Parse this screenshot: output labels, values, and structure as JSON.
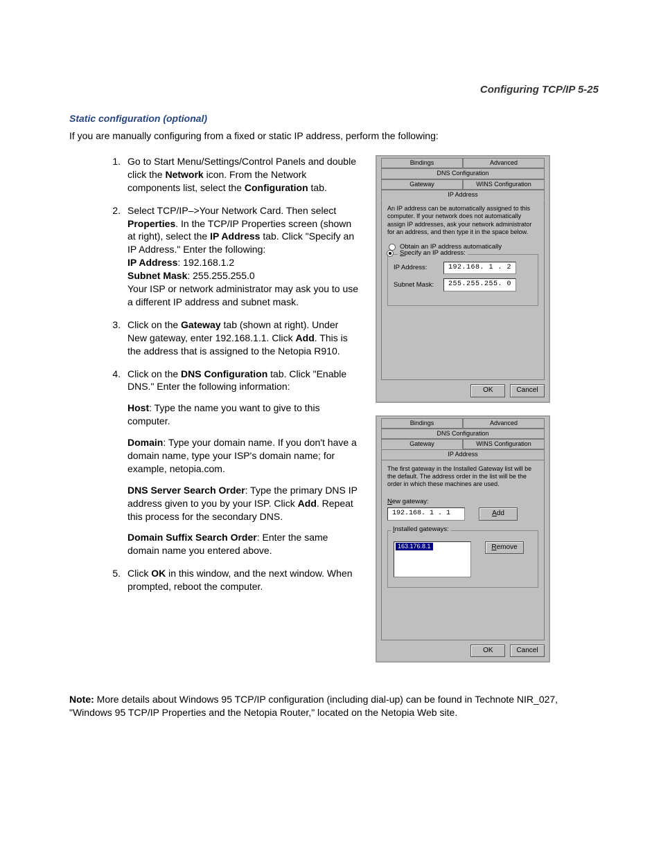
{
  "header": "Configuring TCP/IP   5-25",
  "subhead": "Static configuration (optional)",
  "intro": "If you are manually configuring from a fixed or static IP address, perform the following:",
  "steps": {
    "s1": {
      "pre": "Go to Start Menu/Settings/Control Panels and double click the ",
      "b1": "Network",
      "mid": " icon. From the Network components list, select the ",
      "b2": "Configuration",
      "post": " tab."
    },
    "s2": {
      "pre": "Select TCP/IP–>Your Network Card. Then select ",
      "b1": "Properties",
      "mid1": ". In the TCP/IP Properties screen (shown at right), select the ",
      "b2": "IP Address",
      "mid2": " tab. Click \"Specify an IP Address.\" Enter the following:",
      "ip_label": "IP Address",
      "ip_value": ": 192.168.1.2",
      "sm_label": "Subnet Mask",
      "sm_value": ": 255.255.255.0",
      "tail": "Your ISP or network administrator may ask you to use a different IP address and subnet mask."
    },
    "s3": {
      "pre": "Click on the ",
      "b1": "Gateway",
      "mid": " tab (shown at right). Under New gateway, enter 192.168.1.1. Click ",
      "b2": "Add",
      "post": ". This is the address that is assigned to the Netopia R910."
    },
    "s4": {
      "pre": "Click on the ",
      "b1": "DNS Configuration",
      "post": " tab. Click \"Enable DNS.\" Enter the following information:",
      "host_b": "Host",
      "host_t": ": Type the name you want to give to this computer.",
      "domain_b": "Domain",
      "domain_t": ": Type your domain name. If you don't have a domain name, type your ISP's domain name; for example, netopia.com.",
      "dns_b": "DNS Server Search Order",
      "dns_t": ": Type the primary DNS IP address given to you by your ISP. Click ",
      "dns_b2": "Add",
      "dns_t2": ". Repeat this process for the secondary DNS.",
      "suffix_b": "Domain Suffix Search Order",
      "suffix_t": ": Enter the same domain name you entered above."
    },
    "s5": {
      "pre": "Click ",
      "b1": "OK",
      "post": " in this window, and the next window. When prompted, reboot the computer."
    }
  },
  "note_b": "Note:",
  "note_t": " More details about Windows 95 TCP/IP configuration (including dial-up) can be found in Technote NIR_027, \"Windows 95 TCP/IP Properties and the Netopia Router,\" located on the Netopia Web site.",
  "dialog1": {
    "tabs_row1": [
      "Bindings",
      "Advanced",
      "DNS Configuration"
    ],
    "tabs_row2": [
      "Gateway",
      "WINS Configuration",
      "IP Address"
    ],
    "desc": "An IP address can be automatically assigned to this computer. If your network does not automatically assign IP addresses, ask your network administrator for an address, and then type it in the space below.",
    "radio1_pre": "O",
    "radio1": "btain an IP address automatically",
    "radio2_pre": "S",
    "radio2": "pecify an IP address:",
    "ip_label": "IP Address:",
    "ip_value": "192.168. 1 . 2",
    "sm_label": "Subnet Mask:",
    "sm_value": "255.255.255. 0",
    "ok": "OK",
    "cancel": "Cancel"
  },
  "dialog2": {
    "tabs_row1": [
      "Bindings",
      "Advanced",
      "DNS Configuration"
    ],
    "tabs_row2": ": [Gateway, WINS Configuration, IP Address]",
    "tabs_row2_0": "Gateway",
    "tabs_row2_1": "WINS Configuration",
    "tabs_row2_2": "IP Address",
    "desc": "The first gateway in the Installed Gateway list will be the default. The address order in the list will be the order in which these machines are used.",
    "new_label_pre": "N",
    "new_label": "ew gateway:",
    "new_value": "192.168. 1 . 1",
    "add_pre": "A",
    "add": "dd",
    "inst_label_pre": "I",
    "inst_label": "nstalled gateways:",
    "inst_value": "163.176.8.1",
    "remove_pre": "R",
    "remove": "emove",
    "ok": "OK",
    "cancel": "Cancel"
  }
}
